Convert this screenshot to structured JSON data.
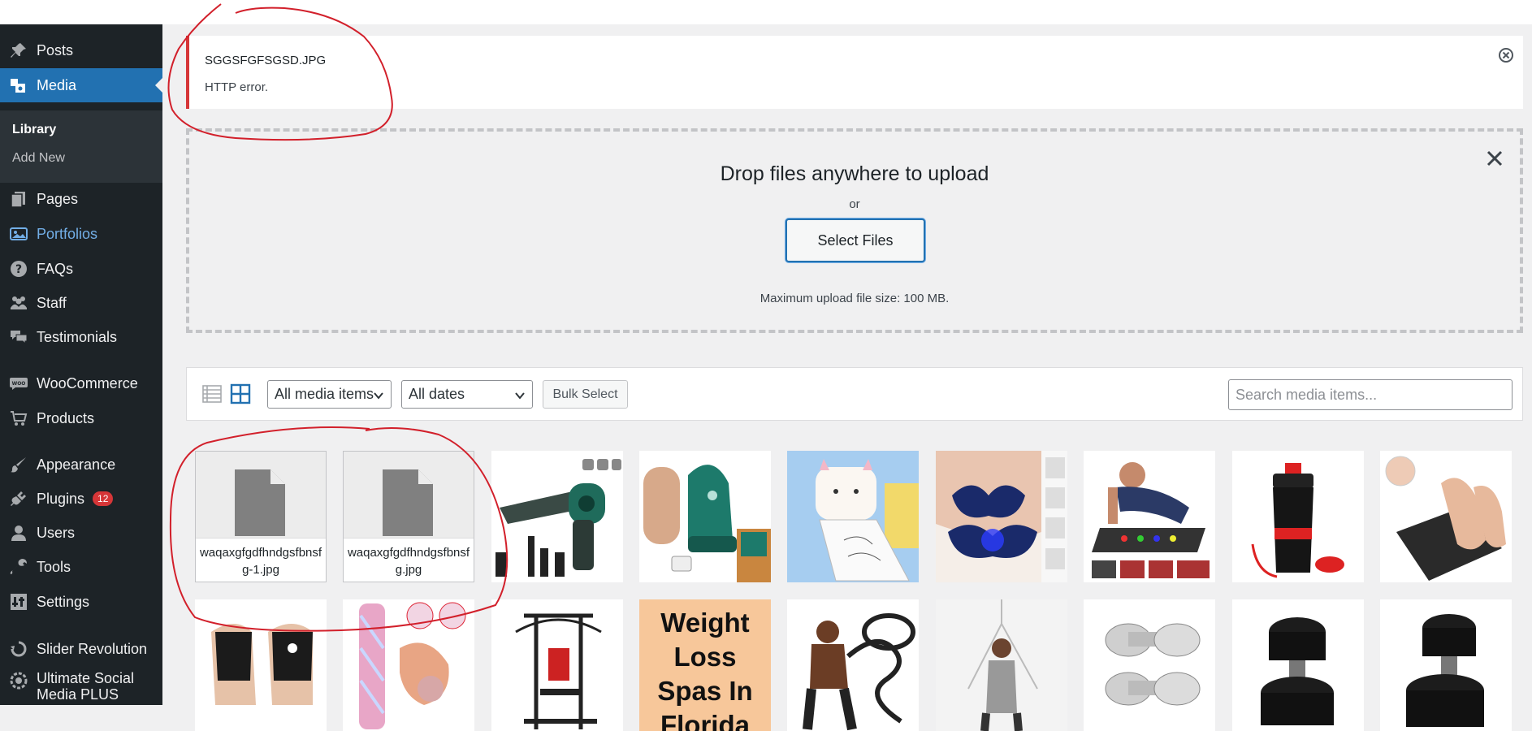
{
  "sidebar": {
    "items": [
      {
        "label": "Posts",
        "icon": "pin-icon"
      },
      {
        "label": "Media",
        "icon": "media-icon"
      },
      {
        "label": "Pages",
        "icon": "pages-icon"
      },
      {
        "label": "Portfolios",
        "icon": "portfolio-icon"
      },
      {
        "label": "FAQs",
        "icon": "question-icon"
      },
      {
        "label": "Staff",
        "icon": "staff-icon"
      },
      {
        "label": "Testimonials",
        "icon": "comments-icon"
      },
      {
        "label": "WooCommerce",
        "icon": "woo-icon"
      },
      {
        "label": "Products",
        "icon": "cart-icon"
      },
      {
        "label": "Appearance",
        "icon": "brush-icon"
      },
      {
        "label": "Plugins",
        "icon": "plug-icon",
        "badge": "12"
      },
      {
        "label": "Users",
        "icon": "user-icon"
      },
      {
        "label": "Tools",
        "icon": "wrench-icon"
      },
      {
        "label": "Settings",
        "icon": "settings-icon"
      },
      {
        "label": "Slider Revolution",
        "icon": "slider-icon"
      },
      {
        "label": "Ultimate Social Media PLUS",
        "icon": "social-icon"
      }
    ],
    "submenu": [
      {
        "label": "Library"
      },
      {
        "label": "Add New"
      }
    ]
  },
  "notice": {
    "filename": "SGGSFGFSGSD.JPG",
    "message": "HTTP error."
  },
  "uploader": {
    "title": "Drop files anywhere to upload",
    "or": "or",
    "button": "Select Files",
    "max_size": "Maximum upload file size: 100 MB."
  },
  "toolbar": {
    "filter_type": "All media items",
    "filter_date": "All dates",
    "bulk_select": "Bulk Select",
    "search_placeholder": "Search media items..."
  },
  "grid": {
    "files": [
      {
        "name": "waqaxgfgdfhndgsfbnsfg-1.jpg"
      },
      {
        "name": "waqaxgfgdfhndgsfbnsfg.jpg"
      }
    ],
    "thumb_text": "Weight Loss Spas In Florida"
  },
  "colors": {
    "sidebar_bg": "#1d2327",
    "accent": "#2271b1",
    "error": "#d63638",
    "annotation": "#d2202b"
  }
}
